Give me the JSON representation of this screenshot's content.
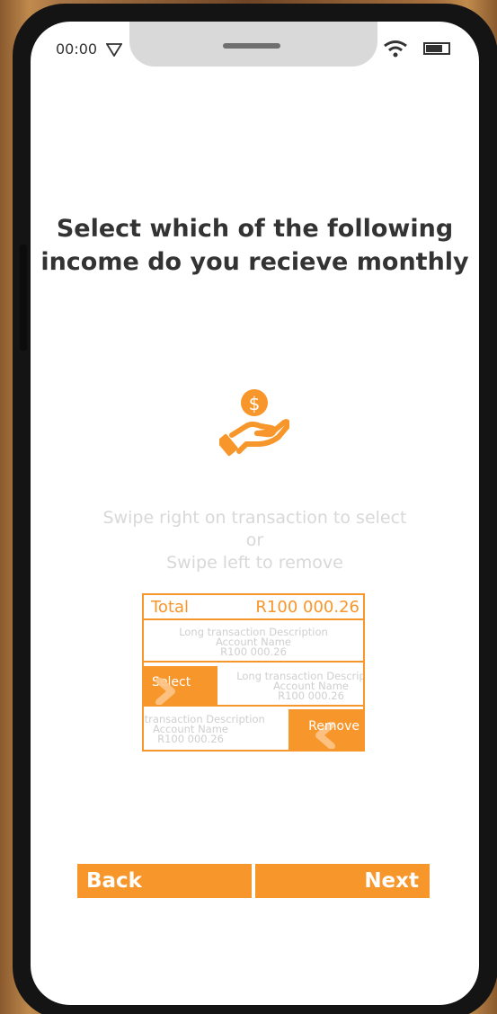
{
  "status_bar": {
    "time": "00:00",
    "signal_icon": "signal-icon",
    "wifi_icon": "wifi-icon",
    "battery_icon": "battery-icon"
  },
  "title": {
    "line1": "Select which of the following",
    "line2": "income do you recieve monthly"
  },
  "hero_icon": "hand-holding-dollar-icon",
  "instructions": {
    "line1": "Swipe right on transaction to select",
    "line2": "or",
    "line3": "Swipe left to remove"
  },
  "demo": {
    "total_label": "Total",
    "total_amount": "R100 000.26",
    "transactions": [
      {
        "description": "Long transaction Description",
        "account": "Account Name",
        "amount": "R100 000.26"
      },
      {
        "description": "Long transaction Description",
        "account": "Account Name",
        "amount": "R100 000.26"
      },
      {
        "description": "Long transaction Description",
        "account": "Account Name",
        "amount": "R100 000.26"
      }
    ],
    "select_label": "Select",
    "remove_label": "Remove"
  },
  "nav": {
    "back_label": "Back",
    "next_label": "Next"
  },
  "colors": {
    "accent": "#f7962a",
    "title_text": "#333333",
    "muted_text": "#d8d8d8"
  }
}
